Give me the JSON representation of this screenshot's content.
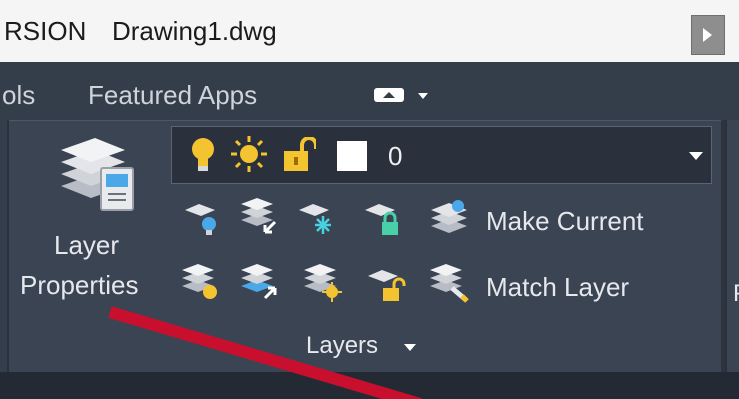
{
  "titlebar": {
    "left_text": "RSION",
    "file_name": "Drawing1.dwg"
  },
  "tabs": {
    "partial_tab": "ols",
    "featured_tab": "Featured Apps",
    "extra_icon": "screen-toggle-icon"
  },
  "layers_panel": {
    "title": "Layers",
    "layer_properties": {
      "line1": "Layer",
      "line2": "Properties",
      "icon": "layer-properties-icon"
    },
    "current_layer": {
      "name": "0",
      "color": "#ffffff",
      "icons": [
        "lightbulb-on-icon",
        "sun-thaw-icon",
        "unlock-icon"
      ]
    },
    "row1_tools": [
      "layer-off-icon",
      "layer-isolate-icon",
      "layer-freeze-icon",
      "layer-lock-icon"
    ],
    "row1_action": {
      "label": "Make Current",
      "icon": "make-current-icon"
    },
    "row2_tools": [
      "layer-on-icon",
      "layer-unisolate-icon",
      "layer-thaw-all-icon",
      "layer-unlock-icon"
    ],
    "row2_action": {
      "label": "Match Layer",
      "icon": "match-layer-icon"
    }
  },
  "right_panel": {
    "partial_label": "P"
  },
  "colors": {
    "panel_bg": "#3b4453",
    "accent_yellow": "#f4c430",
    "accent_blue": "#4aa8e8",
    "annotation_red": "#c8102e"
  }
}
